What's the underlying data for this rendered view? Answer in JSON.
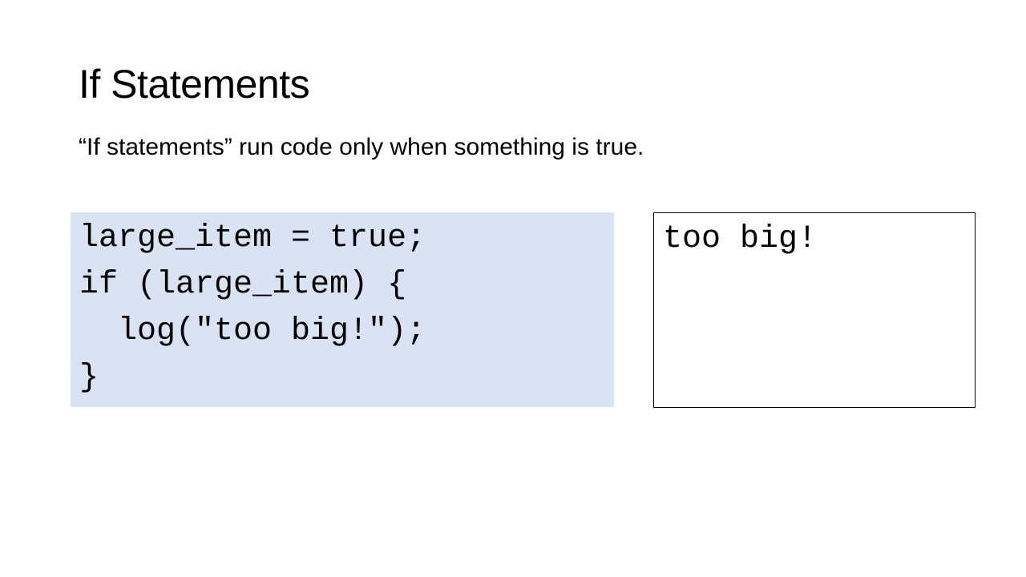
{
  "slide": {
    "title": "If Statements",
    "subtitle": "“If statements” run code only when something is true.",
    "code_lines": [
      "large_item = true;",
      "if (large_item) {",
      "  log(\"too big!\");",
      "}"
    ],
    "output": "too big!",
    "colors": {
      "code_background": "#dae3f3",
      "output_border": "#000000"
    }
  }
}
